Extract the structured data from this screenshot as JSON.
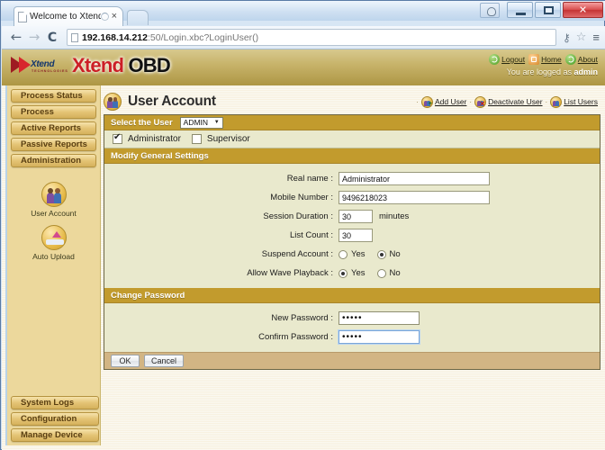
{
  "browser": {
    "tab": {
      "title": "Welcome to Xtend",
      "close_label": "×",
      "spinner_icon": "loading-spinner"
    },
    "new_tab_label": "",
    "nav": {
      "back": "←",
      "forward": "→",
      "reload": "C"
    },
    "url": {
      "host": "192.168.14.212",
      "rest": ":50/Login.xbc?LoginUser()"
    },
    "omnibox_icons": {
      "key": "⚷",
      "star": "☆",
      "menu": "≡"
    },
    "window_controls": {
      "minimize": "–",
      "maximize": "▫",
      "close": "✕",
      "user": "user-icon"
    }
  },
  "site": {
    "brand": {
      "logo_text": "Xtend",
      "logo_sub": "TECHNOLOGIES",
      "title_red": "Xtend",
      "title_black": "OBD"
    },
    "header_links": [
      {
        "label": "Logout",
        "icon": "logout-icon"
      },
      {
        "label": "Home",
        "icon": "home-icon"
      },
      {
        "label": "About",
        "icon": "about-icon"
      }
    ],
    "separator": "·",
    "logged_prefix": "You are logged as ",
    "logged_user": "admin"
  },
  "sidebar": {
    "top_items": [
      {
        "label": "Process Status"
      },
      {
        "label": "Process"
      },
      {
        "label": "Active Reports"
      },
      {
        "label": "Passive Reports"
      },
      {
        "label": "Administration"
      }
    ],
    "icon_items": [
      {
        "label": "User Account",
        "icon": "users-icon"
      },
      {
        "label": "Auto Upload",
        "icon": "upload-icon"
      }
    ],
    "bottom_items": [
      {
        "label": "System Logs"
      },
      {
        "label": "Configuration"
      },
      {
        "label": "Manage Device"
      }
    ]
  },
  "page": {
    "title": "User Account",
    "title_icon": "users-icon",
    "actions": [
      {
        "label": "Add User",
        "icon": "add-user-icon"
      },
      {
        "label": "Deactivate User",
        "icon": "deactivate-user-icon"
      },
      {
        "label": "List Users",
        "icon": "list-users-icon"
      }
    ],
    "action_separator": "·",
    "select_user": {
      "label": "Select the User",
      "value": "ADMIN",
      "caret": "▼",
      "options": [
        "ADMIN"
      ]
    },
    "roles": [
      {
        "label": "Administrator",
        "checked": true
      },
      {
        "label": "Supervisor",
        "checked": false
      }
    ],
    "general_settings": {
      "heading": "Modify General Settings",
      "fields": [
        {
          "label": "Real name :",
          "value": "Administrator",
          "type": "text-wide"
        },
        {
          "label": "Mobile Number :",
          "value": "9496218023",
          "type": "text-wide"
        },
        {
          "label": "Session Duration :",
          "value": "30",
          "type": "text-small",
          "unit": "minutes"
        },
        {
          "label": "List Count :",
          "value": "30",
          "type": "text-small",
          "unit": ""
        }
      ],
      "radios": [
        {
          "label": "Suspend Account :",
          "yes_label": "Yes",
          "no_label": "No",
          "selected": "No"
        },
        {
          "label": "Allow Wave Playback :",
          "yes_label": "Yes",
          "no_label": "No",
          "selected": "Yes"
        }
      ]
    },
    "change_password": {
      "heading": "Change Password",
      "fields": [
        {
          "label": "New Password :",
          "value": "•••••"
        },
        {
          "label": "Confirm Password :",
          "value": "•••••"
        }
      ]
    },
    "buttons": {
      "ok": "OK",
      "cancel": "Cancel"
    }
  },
  "colors": {
    "gold_bar": "#c29b2d",
    "panel_bg": "#e9e9cd",
    "sidebar_bg": "#ecd89c",
    "button_row": "#d2b584",
    "brand_red": "#cc1f26"
  }
}
